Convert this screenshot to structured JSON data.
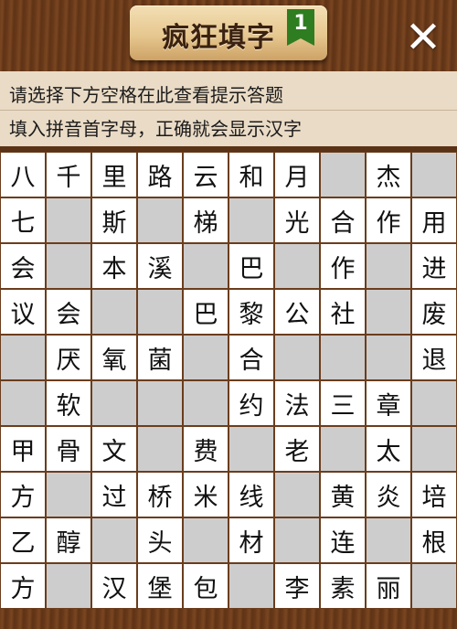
{
  "header": {
    "title": "疯狂填字",
    "level": "1",
    "close_icon": "close-icon"
  },
  "hint": {
    "line1": "请选择下方空格在此查看提示答题",
    "line2": "填入拼音首字母，正确就会显示汉字"
  },
  "colors": {
    "wood": "#6d3d1b",
    "hint_bg": "#eadbc6",
    "filled_cell": "#ffffff",
    "empty_cell": "#cdcdcd",
    "badge": "#2f7d21"
  },
  "grid": [
    [
      "八",
      "千",
      "里",
      "路",
      "云",
      "和",
      "月",
      "",
      "杰",
      ""
    ],
    [
      "七",
      "",
      "斯",
      "",
      "梯",
      "",
      "光",
      "合",
      "作",
      "用"
    ],
    [
      "会",
      "",
      "本",
      "溪",
      "",
      "巴",
      "",
      "作",
      "",
      "进"
    ],
    [
      "议",
      "会",
      "",
      "",
      "巴",
      "黎",
      "公",
      "社",
      "",
      "废"
    ],
    [
      "",
      "厌",
      "氧",
      "菌",
      "",
      "合",
      "",
      "",
      "",
      "退"
    ],
    [
      "",
      "软",
      "",
      "",
      "",
      "约",
      "法",
      "三",
      "章",
      ""
    ],
    [
      "甲",
      "骨",
      "文",
      "",
      "费",
      "",
      "老",
      "",
      "太",
      ""
    ],
    [
      "方",
      "",
      "过",
      "桥",
      "米",
      "线",
      "",
      "黄",
      "炎",
      "培"
    ],
    [
      "乙",
      "醇",
      "",
      "头",
      "",
      "材",
      "",
      "连",
      "",
      "根"
    ],
    [
      "方",
      "",
      "汉",
      "堡",
      "包",
      "",
      "李",
      "素",
      "丽",
      ""
    ]
  ]
}
